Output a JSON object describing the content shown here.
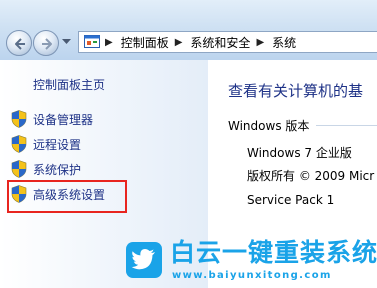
{
  "address_bar": {
    "breadcrumbs": [
      "控制面板",
      "系统和安全",
      "系统"
    ]
  },
  "left_pane": {
    "home_link": "控制面板主页",
    "tasks": [
      {
        "label": "设备管理器",
        "icon": "uac-shield-icon"
      },
      {
        "label": "远程设置",
        "icon": "uac-shield-icon"
      },
      {
        "label": "系统保护",
        "icon": "uac-shield-icon"
      },
      {
        "label": "高级系统设置",
        "icon": "uac-shield-icon",
        "highlighted": true
      }
    ]
  },
  "main": {
    "title": "查看有关计算机的基",
    "edition_section": "Windows 版本",
    "edition": "Windows 7 企业版",
    "copyright": "版权所有 © 2009 Micr",
    "service_pack": "Service Pack 1"
  },
  "watermark": {
    "text": "白云一键重装系统",
    "url": "www.baiyunxitong.com",
    "color": "#1aa3e8"
  },
  "colors": {
    "link": "#1e3287",
    "highlight_border": "#e8251f"
  }
}
